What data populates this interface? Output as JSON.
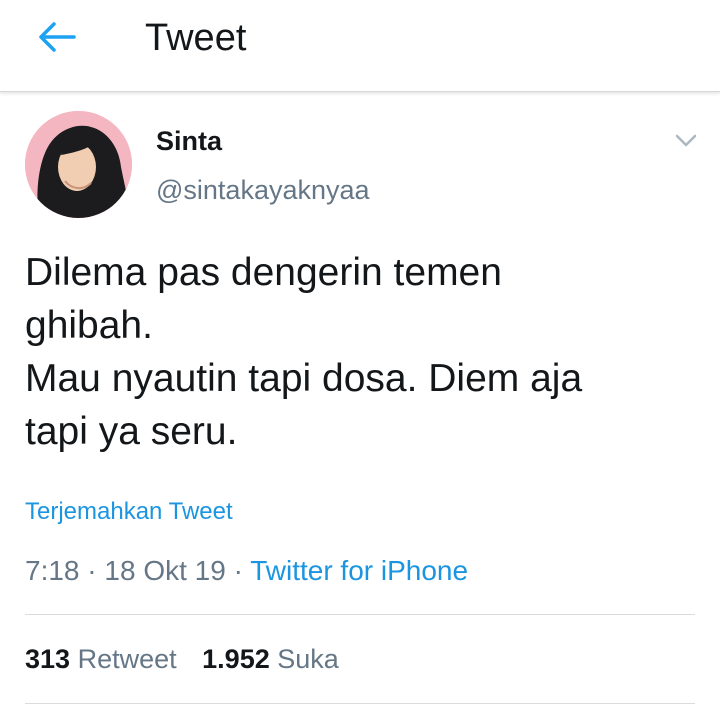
{
  "header": {
    "title": "Tweet",
    "back_icon": "arrow-left-icon",
    "accent": "#1da1f2"
  },
  "tweet": {
    "display_name": "Sinta",
    "username": "@sintakayaknyaa",
    "more_icon": "chevron-down-icon",
    "text": "Dilema pas dengerin temen\nghibah.\nMau nyautin tapi dosa. Diem aja\ntapi ya seru.",
    "translate_label": "Terjemahkan Tweet",
    "time": "7:18",
    "date": "18 Okt 19",
    "separator": "·",
    "source": "Twitter for iPhone"
  },
  "stats": {
    "retweets_count": "313",
    "retweets_label": "Retweet",
    "likes_count": "1.952",
    "likes_label": "Suka"
  },
  "colors": {
    "link": "#1b95e0",
    "secondary_text": "#657786",
    "avatar_bg": "#f4b7c1"
  }
}
